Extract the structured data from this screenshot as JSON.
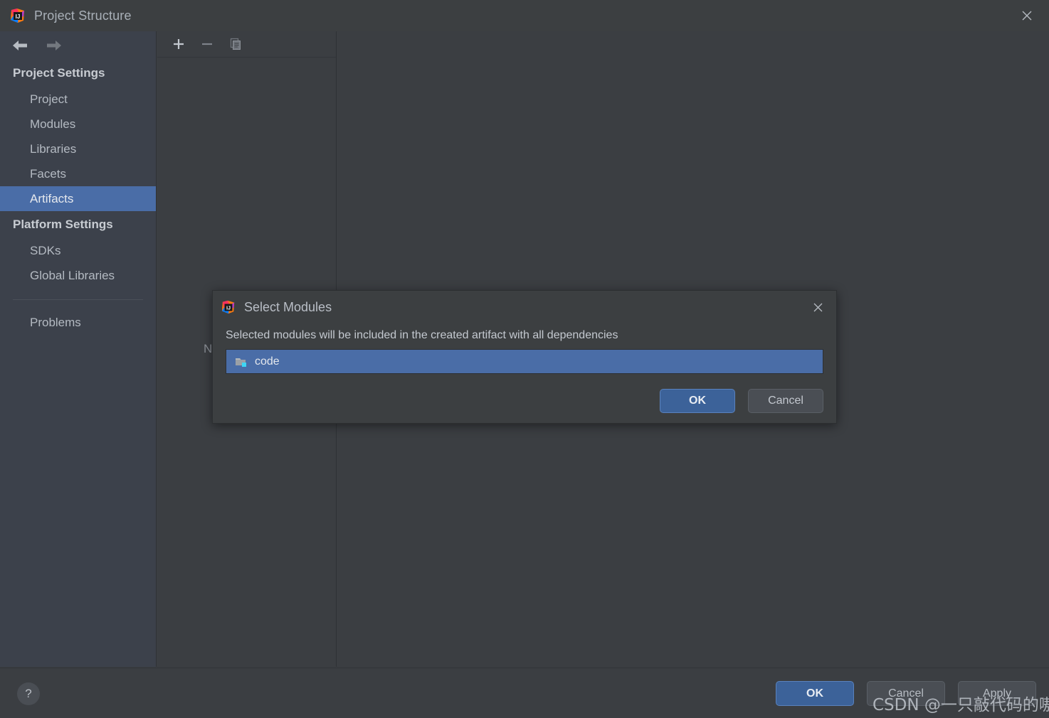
{
  "window": {
    "title": "Project Structure",
    "app_icon": "intellij-idea-icon",
    "close_label": "close-icon"
  },
  "nav": {
    "back": "back-arrow-icon",
    "forward": "forward-arrow-icon"
  },
  "sidebar": {
    "groups": [
      {
        "label": "Project Settings",
        "items": [
          {
            "label": "Project",
            "selected": false
          },
          {
            "label": "Modules",
            "selected": false
          },
          {
            "label": "Libraries",
            "selected": false
          },
          {
            "label": "Facets",
            "selected": false
          },
          {
            "label": "Artifacts",
            "selected": true
          }
        ]
      },
      {
        "label": "Platform Settings",
        "items": [
          {
            "label": "SDKs",
            "selected": false
          },
          {
            "label": "Global Libraries",
            "selected": false
          }
        ]
      }
    ],
    "extra": [
      {
        "label": "Problems",
        "selected": false
      }
    ]
  },
  "center_panel": {
    "toolbar": [
      {
        "name": "add-button",
        "icon": "plus-icon"
      },
      {
        "name": "remove-button",
        "icon": "minus-icon"
      },
      {
        "name": "copy-button",
        "icon": "copy-icon"
      }
    ],
    "empty_text": "Nothing to show"
  },
  "dialog": {
    "icon": "intellij-idea-icon",
    "title": "Select Modules",
    "close_label": "close-icon",
    "description": "Selected modules will be included in the created artifact with all dependencies",
    "modules": [
      {
        "label": "code",
        "icon": "module-folder-icon",
        "selected": true
      }
    ],
    "ok_label": "OK",
    "cancel_label": "Cancel"
  },
  "footer": {
    "help_label": "?",
    "ok_label": "OK",
    "cancel_label": "Cancel",
    "apply_label": "Apply"
  },
  "watermark": {
    "text": "CSDN @一只敲代码的嗷呜"
  },
  "colors": {
    "accent_blue": "#4a6da7",
    "primary_button": "#3c6299",
    "sidebar_bg": "#3c414b",
    "panel_bg": "#3b3e42",
    "titlebar_bg": "#3c3f41",
    "text_primary": "#c3c8cf",
    "text_muted": "#8a8f96"
  }
}
